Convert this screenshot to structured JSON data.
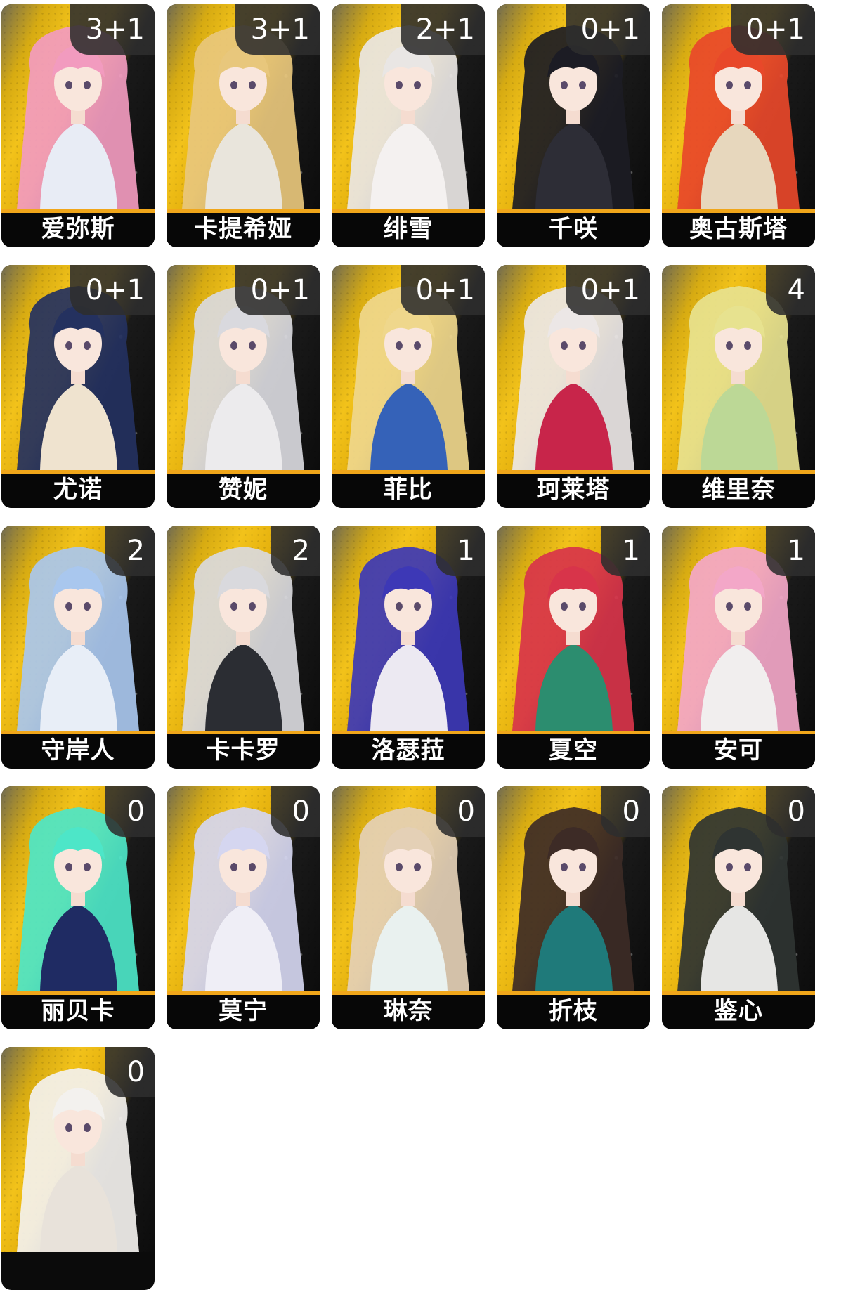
{
  "characters": [
    {
      "name": "爱弥斯",
      "count": "3+1",
      "hair": "#f29bbf",
      "outfit": "#e8ecf5"
    },
    {
      "name": "卡提希娅",
      "count": "3+1",
      "hair": "#e8c77c",
      "outfit": "#e9e5dc"
    },
    {
      "name": "绯雪",
      "count": "2+1",
      "hair": "#e9e6e4",
      "outfit": "#f4f1f0"
    },
    {
      "name": "千咲",
      "count": "0+1",
      "hair": "#1c1c24",
      "outfit": "#2d2d36"
    },
    {
      "name": "奥古斯塔",
      "count": "0+1",
      "hair": "#e8482a",
      "outfit": "#e7d7bd"
    },
    {
      "name": "尤诺",
      "count": "0+1",
      "hair": "#24315f",
      "outfit": "#efe3cf"
    },
    {
      "name": "赞妮",
      "count": "0+1",
      "hair": "#d9d9de",
      "outfit": "#ecebed"
    },
    {
      "name": "菲比",
      "count": "0+1",
      "hair": "#efd78c",
      "outfit": "#3562b8"
    },
    {
      "name": "珂莱塔",
      "count": "0+1",
      "hair": "#ece7e6",
      "outfit": "#c8254a"
    },
    {
      "name": "维里奈",
      "count": "4",
      "hair": "#e7e28f",
      "outfit": "#bcd896"
    },
    {
      "name": "守岸人",
      "count": "2",
      "hair": "#a9c7ee",
      "outfit": "#e8eef7"
    },
    {
      "name": "卡卡罗",
      "count": "2",
      "hair": "#d9d9dd",
      "outfit": "#2b2d33"
    },
    {
      "name": "洛瑟菈",
      "count": "1",
      "hair": "#3d38b6",
      "outfit": "#ece9f2"
    },
    {
      "name": "夏空",
      "count": "1",
      "hair": "#d8344a",
      "outfit": "#2c8d6f"
    },
    {
      "name": "安可",
      "count": "1",
      "hair": "#f3a7c8",
      "outfit": "#f1eeee"
    },
    {
      "name": "丽贝卡",
      "count": "0",
      "hair": "#4de6c8",
      "outfit": "#1f2b63"
    },
    {
      "name": "莫宁",
      "count": "0",
      "hair": "#d5d6f0",
      "outfit": "#efeef6"
    },
    {
      "name": "琳奈",
      "count": "0",
      "hair": "#e4d0b6",
      "outfit": "#e9f1ef"
    },
    {
      "name": "折枝",
      "count": "0",
      "hair": "#3d2b26",
      "outfit": "#1f7a7a"
    },
    {
      "name": "鉴心",
      "count": "0",
      "hair": "#2f3432",
      "outfit": "#e6e6e4"
    },
    {
      "name": "",
      "count": "0",
      "hair": "#f3f1ee",
      "outfit": "#e8e2da"
    }
  ],
  "theme": {
    "card_bg": "#0b0b0b",
    "name_bar": "#070707",
    "accent_line": "#f0a61a",
    "badge_bg": "#2d2d2d",
    "art_yellow": "#f2c21a"
  }
}
